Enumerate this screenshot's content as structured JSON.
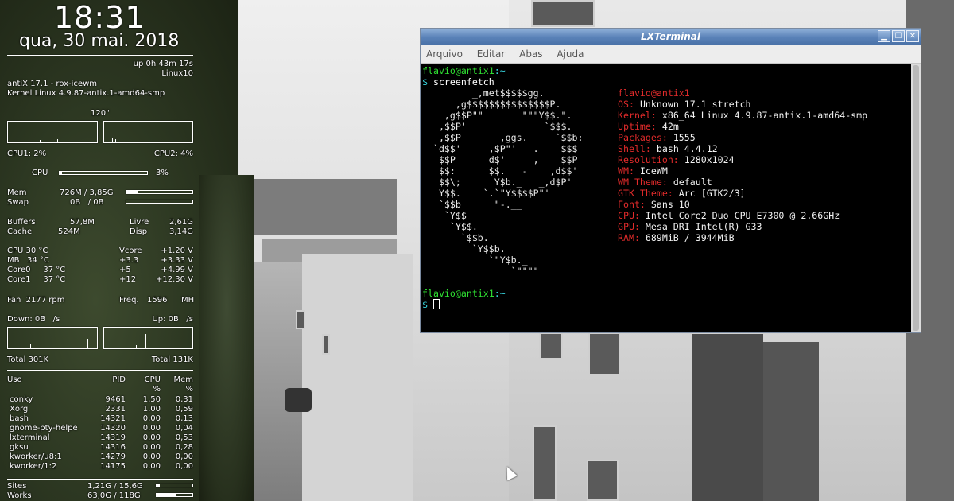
{
  "conky": {
    "time": "18:31",
    "date": "qua, 30 mai. 2018",
    "uptime": "up 0h 43m 17s",
    "host": "Linux10",
    "distro": "antiX 17.1 - rox-icewm",
    "kernel": "Kernel Linux 4.9.87-antix.1-amd64-smp",
    "cpu_graph_label": "120\"",
    "cpu1": "CPU1: 2%",
    "cpu2": "CPU2: 4%",
    "cpu_label": "CPU",
    "cpu_pct": "3%",
    "cpu_pct_value": 0.03,
    "mem_label": "Mem",
    "mem_value": "726M / 3,85G",
    "mem_fraction": 0.18,
    "swap_label": "Swap",
    "swap_value": "0B   / 0B",
    "swap_fraction": 0.0,
    "buffers_label": "Buffers",
    "buffers_value": "57,8M",
    "livre_label": "Livre",
    "livre_value": "2,61G",
    "cache_label": "Cache",
    "cache_value": "524M",
    "disp_label": "Disp",
    "disp_value": "3,14G",
    "temps": [
      {
        "l": "CPU 30 °C",
        "m": "Vcore",
        "r": "+1.20 V"
      },
      {
        "l": "MB   34 °C",
        "m": "+3.3",
        "r": "+3.33 V"
      },
      {
        "l": "Core0     37 °C",
        "m": "+5",
        "r": "+4.99 V"
      },
      {
        "l": "Core1     37 °C",
        "m": "+12",
        "r": "+12.30 V"
      }
    ],
    "fan": "Fan  2177 rpm",
    "freq_label": "Freq.",
    "freq_value": "1596",
    "freq_unit": "MH",
    "down": "Down: 0B   /s",
    "up": "Up: 0B   /s",
    "total_down": "Total 301K",
    "total_up": "Total 131K",
    "proc_header": {
      "name": "Uso",
      "pid": "PID",
      "cpu": "CPU\n%",
      "mem": "Mem\n%"
    },
    "processes": [
      {
        "name": "conky",
        "pid": "9461",
        "cpu": "1,50",
        "mem": "0,31"
      },
      {
        "name": "Xorg",
        "pid": "2331",
        "cpu": "1,00",
        "mem": "0,59"
      },
      {
        "name": "bash",
        "pid": "14321",
        "cpu": "0,00",
        "mem": "0,13"
      },
      {
        "name": "gnome-pty-helpe",
        "pid": "14320",
        "cpu": "0,00",
        "mem": "0,04"
      },
      {
        "name": "lxterminal",
        "pid": "14319",
        "cpu": "0,00",
        "mem": "0,53"
      },
      {
        "name": "gksu",
        "pid": "14316",
        "cpu": "0,00",
        "mem": "0,28"
      },
      {
        "name": "kworker/u8:1",
        "pid": "14279",
        "cpu": "0,00",
        "mem": "0,00"
      },
      {
        "name": "kworker/1:2",
        "pid": "14175",
        "cpu": "0,00",
        "mem": "0,00"
      }
    ],
    "sites_label": "Sites",
    "sites_value": "1,21G / 15,6G",
    "sites_fraction": 0.08,
    "works_label": "Works",
    "works_value": "63,0G / 118G",
    "works_fraction": 0.53
  },
  "terminal": {
    "title": "LXTerminal",
    "menu": [
      "Arquivo",
      "Editar",
      "Abas",
      "Ajuda"
    ],
    "prompt_user": "flavio@antix1",
    "prompt_sep": ":~",
    "prompt_symbol": "$",
    "command": "screenfetch",
    "logo": [
      "         _,met$$$$$gg.",
      "      ,g$$$$$$$$$$$$$$$P.",
      "    ,g$$P\"\"       \"\"\"Y$$.\".",
      "   ,$$P'              `$$$.",
      "  ',$$P       ,ggs.     `$$b:",
      "  `d$$'     ,$P\"'   .    $$$",
      "   $$P      d$'     ,    $$P",
      "   $$:      $$.   -    ,d$$'",
      "   $$\\;      Y$b._   _,d$P'",
      "   Y$$.    `.`\"Y$$$$P\"'",
      "   `$$b      \"-.__",
      "    `Y$$",
      "     `Y$$.",
      "       `$$b.",
      "         `Y$$b.",
      "            `\"Y$b._",
      "                `\"\"\"\""
    ],
    "info_user": "flavio@antix1",
    "info": [
      {
        "k": "OS:",
        "v": "Unknown 17.1 stretch"
      },
      {
        "k": "Kernel:",
        "v": "x86_64 Linux 4.9.87-antix.1-amd64-smp"
      },
      {
        "k": "Uptime:",
        "v": "42m"
      },
      {
        "k": "Packages:",
        "v": "1555"
      },
      {
        "k": "Shell:",
        "v": "bash 4.4.12"
      },
      {
        "k": "Resolution:",
        "v": "1280x1024"
      },
      {
        "k": "WM:",
        "v": "IceWM"
      },
      {
        "k": "WM Theme:",
        "v": "default"
      },
      {
        "k": "GTK Theme:",
        "v": "Arc [GTK2/3]"
      },
      {
        "k": "Font:",
        "v": "Sans 10"
      },
      {
        "k": "CPU:",
        "v": "Intel Core2 Duo CPU E7300 @ 2.66GHz"
      },
      {
        "k": "GPU:",
        "v": "Mesa DRI Intel(R) G33"
      },
      {
        "k": "RAM:",
        "v": "689MiB / 3944MiB"
      }
    ]
  }
}
